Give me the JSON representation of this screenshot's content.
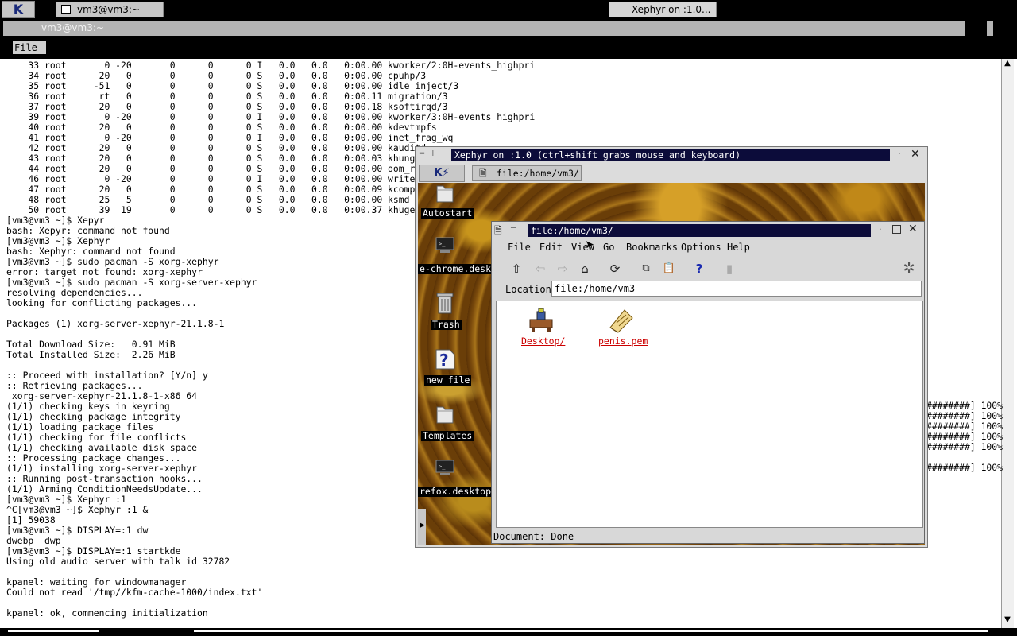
{
  "taskbar": {
    "k_button": "K",
    "tasks": [
      "vm3@vm3:~",
      "Xephyr on :1.0..."
    ]
  },
  "terminal": {
    "title": "vm3@vm3:~",
    "menu_file": "File",
    "lines": [
      "    33 root       0 -20       0      0      0 I   0.0   0.0   0:00.00 kworker/2:0H-events_highpri",
      "    34 root      20   0       0      0      0 S   0.0   0.0   0:00.00 cpuhp/3",
      "    35 root     -51   0       0      0      0 S   0.0   0.0   0:00.00 idle_inject/3",
      "    36 root      rt   0       0      0      0 S   0.0   0.0   0:00.11 migration/3",
      "    37 root      20   0       0      0      0 S   0.0   0.0   0:00.18 ksoftirqd/3",
      "    39 root       0 -20       0      0      0 I   0.0   0.0   0:00.00 kworker/3:0H-events_highpri",
      "    40 root      20   0       0      0      0 S   0.0   0.0   0:00.00 kdevtmpfs",
      "    41 root       0 -20       0      0      0 I   0.0   0.0   0:00.00 inet_frag_wq",
      "    42 root      20   0       0      0      0 S   0.0   0.0   0:00.00 kauditd",
      "    43 root      20   0       0      0      0 S   0.0   0.0   0:00.03 khungtaskd",
      "    44 root      20   0       0      0      0 S   0.0   0.0   0:00.00 oom_reaper",
      "    46 root       0 -20       0      0      0 I   0.0   0.0   0:00.00 writeback",
      "    47 root      20   0       0      0      0 S   0.0   0.0   0:00.09 kcompactd0",
      "    48 root      25   5       0      0      0 S   0.0   0.0   0:00.00 ksmd",
      "    50 root      39  19       0      0      0 S   0.0   0.0   0:00.37 khugepaged",
      "[vm3@vm3 ~]$ Xepyr",
      "bash: Xepyr: command not found",
      "[vm3@vm3 ~]$ Xephyr",
      "bash: Xephyr: command not found",
      "[vm3@vm3 ~]$ sudo pacman -S xorg-xephyr",
      "error: target not found: xorg-xephyr",
      "[vm3@vm3 ~]$ sudo pacman -S xorg-server-xephyr",
      "resolving dependencies...",
      "looking for conflicting packages...",
      "",
      "Packages (1) xorg-server-xephyr-21.1.8-1",
      "",
      "Total Download Size:   0.91 MiB",
      "Total Installed Size:  2.26 MiB",
      "",
      ":: Proceed with installation? [Y/n] y",
      ":: Retrieving packages...",
      " xorg-server-xephyr-21.1.8-1-x86_64",
      "(1/1) checking keys in keyring",
      "(1/1) checking package integrity",
      "(1/1) loading package files",
      "(1/1) checking for file conflicts",
      "(1/1) checking available disk space",
      ":: Processing package changes...",
      "(1/1) installing xorg-server-xephyr",
      ":: Running post-transaction hooks...",
      "(1/1) Arming ConditionNeedsUpdate...",
      "[vm3@vm3 ~]$ Xephyr :1",
      "^C[vm3@vm3 ~]$ Xephyr :1 &",
      "[1] 59038",
      "[vm3@vm3 ~]$ DISPLAY=:1 dw",
      "dwebp  dwp",
      "[vm3@vm3 ~]$ DISPLAY=:1 startkde",
      "Using old audio server with talk id 32782",
      "",
      "kpanel: waiting for windowmanager",
      "Could not read '/tmp//kfm-cache-1000/index.txt'",
      "",
      "kpanel: ok, commencing initialization"
    ],
    "progress_lines": [
      "########] 100%",
      "########] 100%",
      "########] 100%",
      "########] 100%",
      "########] 100%",
      "",
      "########] 100%"
    ]
  },
  "xephyr": {
    "title": "Xephyr on :1.0 (ctrl+shift grabs mouse and keyboard)",
    "panel_k": "K",
    "panel_task": "file:/home/vm3/",
    "desktop_icons": [
      {
        "label": "Autostart",
        "icon": "folder-icon"
      },
      {
        "label": "e-chrome.deskto",
        "icon": "terminal-icon"
      },
      {
        "label": "Trash",
        "icon": "trash-icon"
      },
      {
        "label": "new file",
        "icon": "question-icon"
      },
      {
        "label": "Templates",
        "icon": "folder-icon"
      },
      {
        "label": "refox.desktop",
        "icon": "terminal-icon"
      }
    ]
  },
  "konqueror": {
    "title": "file:/home/vm3/",
    "menu": [
      "File",
      "Edit",
      "View",
      "Go",
      "Bookmarks",
      "Options",
      "Help"
    ],
    "toolbar_icons": [
      "up-arrow-icon",
      "back-arrow-icon",
      "forward-arrow-icon",
      "home-icon",
      "reload-icon",
      "copy-icon",
      "paste-icon",
      "help-icon",
      "stop-icon"
    ],
    "location_label": "Location:",
    "location_value": "file:/home/vm3",
    "files": [
      "Desktop/",
      "penis.pem"
    ],
    "status": "Document: Done"
  }
}
